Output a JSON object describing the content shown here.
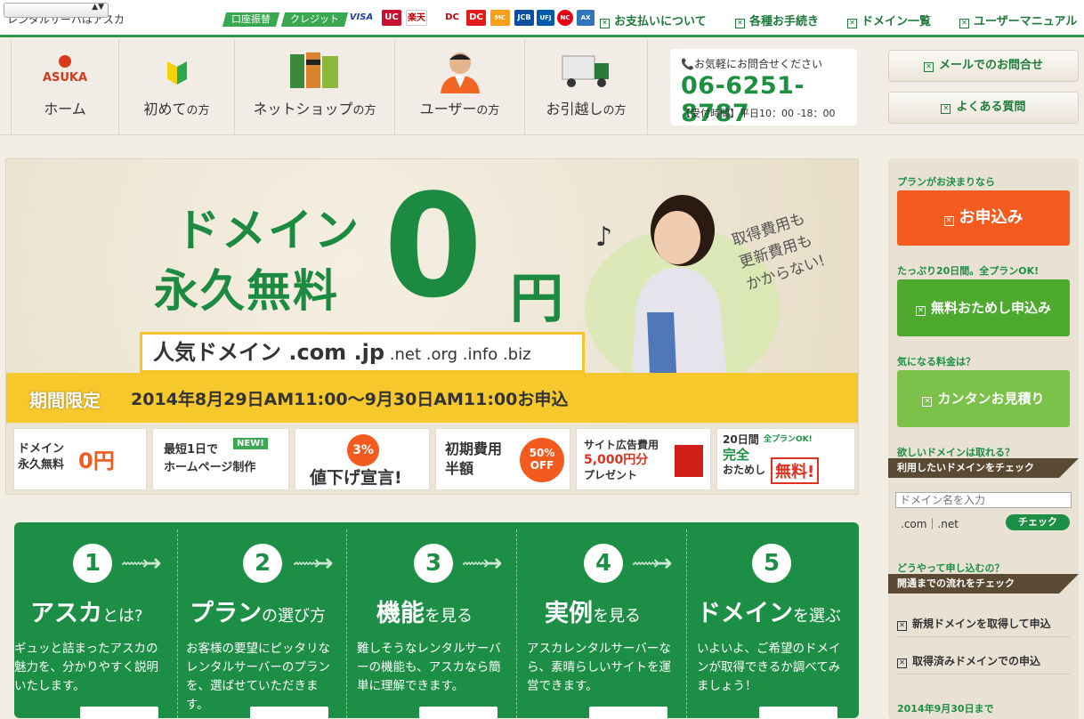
{
  "site_title": "レンタルサーバはアスカ",
  "payment_tags": [
    "口座振替",
    "クレジット"
  ],
  "cards": [
    "VISA",
    "UC",
    "楽天",
    "DC",
    "MC",
    "JCB",
    "UFJ",
    "NC",
    "AX"
  ],
  "top_links": [
    "お支払いについて",
    "各種お手続き",
    "ドメイン一覧",
    "ユーザーマニュアル"
  ],
  "logo_text": "ASUKA",
  "nav": [
    {
      "label": "ホーム",
      "suffix": ""
    },
    {
      "label": "初めて",
      "suffix": "の方"
    },
    {
      "label": "ネットショップ",
      "suffix": "の方"
    },
    {
      "label": "ユーザー",
      "suffix": "の方"
    },
    {
      "label": "お引越し",
      "suffix": "の方"
    }
  ],
  "phone": {
    "caption": "お気軽にお問合せください",
    "number": "06-6251-8787",
    "hours": "【受付時間】平日10：00 -18：00"
  },
  "side_buttons": [
    "メールでのお問合せ",
    "よくある質問"
  ],
  "hero": {
    "line1": "ドメイン",
    "line2": "永久無料",
    "zero": "0",
    "yen": "円",
    "domains_big": "人気ドメイン .com .jp",
    "domains_small": " .net .org .info .biz",
    "limited_tag": "期間限定",
    "limited_text": "2014年8月29日AM11:00〜9月30日AM11:00お申込",
    "cost_note": [
      "取得費用も",
      "更新費用も",
      "かからない!"
    ]
  },
  "banners": [
    {
      "line1": "ドメイン",
      "line2": "永久無料",
      "big": "0円"
    },
    {
      "line1": "最短1日で",
      "line2": "ホームページ制作",
      "badge": "NEW!"
    },
    {
      "line1": "3%",
      "line2": "値下げ宣言!"
    },
    {
      "line1": "初期費用",
      "line2": "半額",
      "badge": "50% OFF"
    },
    {
      "line1": "サイト広告費用",
      "line2": "5,000円分",
      "line3": "プレゼント"
    },
    {
      "line1": "20日間",
      "line2": "完全",
      "line3": "おためし",
      "badge": "無料!",
      "tag": "全プランOK!"
    }
  ],
  "steps": [
    {
      "num": "1",
      "title": "アスカ",
      "suffix": "とは?",
      "desc": "ギュッと詰まったアスカの魅力を、分かりやすく説明いたします。"
    },
    {
      "num": "2",
      "title": "プラン",
      "suffix": "の選び方",
      "desc": "お客様の要望にピッタリなレンタルサーバーのプランを、選ばせていただきます。"
    },
    {
      "num": "3",
      "title": "機能",
      "suffix": "を見る",
      "desc": "難しそうなレンタルサーバーの機能も、アスカなら簡単に理解できます。"
    },
    {
      "num": "4",
      "title": "実例",
      "suffix": "を見る",
      "desc": "アスカレンタルサーバーなら、素晴らしいサイトを運営できます。"
    },
    {
      "num": "5",
      "title": "ドメイン",
      "suffix": "を選ぶ",
      "desc": "いよいよ、ご希望のドメインが取得できるか調べてみましょう！"
    }
  ],
  "right": {
    "cap1": "プランがお決まりなら",
    "apply": "お申込み",
    "cap2": "たっぷり20日間。全プランOK!",
    "trial": "無料おためし申込み",
    "cap3": "気になる料金は？",
    "estimate": "カンタンお見積り",
    "cap4": "欲しいドメインは取れる？",
    "dark1": "利用したいドメインをチェック",
    "input_placeholder": "ドメイン名を入力",
    "tld": ".com｜.net",
    "check": "チェック",
    "cap5": "どうやって申し込むの？",
    "dark2": "開通までの流れをチェック",
    "link1": "新規ドメインを取得して申込",
    "link2": "取得済みドメインでの申込",
    "cap6": "2014年9月30日まで"
  },
  "colors": {
    "brand_green": "#1d8e45",
    "orange": "#f55a1e",
    "light_green": "#5cb33a",
    "yellow": "#f6c82c"
  }
}
